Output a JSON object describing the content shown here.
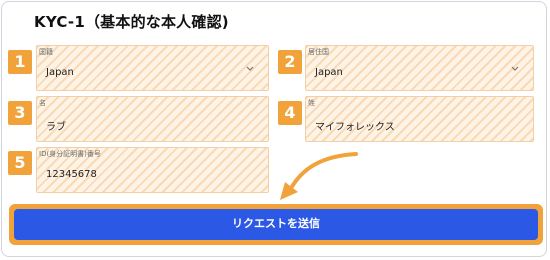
{
  "title": "KYC-1（基本的な本人確認)",
  "fields": [
    {
      "number": "1",
      "label": "国籍",
      "value": "Japan",
      "type": "select"
    },
    {
      "number": "2",
      "label": "居住国",
      "value": "Japan",
      "type": "select"
    },
    {
      "number": "3",
      "label": "名",
      "value": "ラブ",
      "type": "text"
    },
    {
      "number": "4",
      "label": "姓",
      "value": "マイフォレックス",
      "type": "text"
    },
    {
      "number": "5",
      "label": "ID(身分証明書)番号",
      "value": "12345678",
      "type": "text"
    }
  ],
  "submit_label": "リクエストを送信",
  "colors": {
    "accent_orange": "#f2a23a",
    "button_blue": "#2b59e6",
    "field_fill": "#fdf3e6"
  }
}
